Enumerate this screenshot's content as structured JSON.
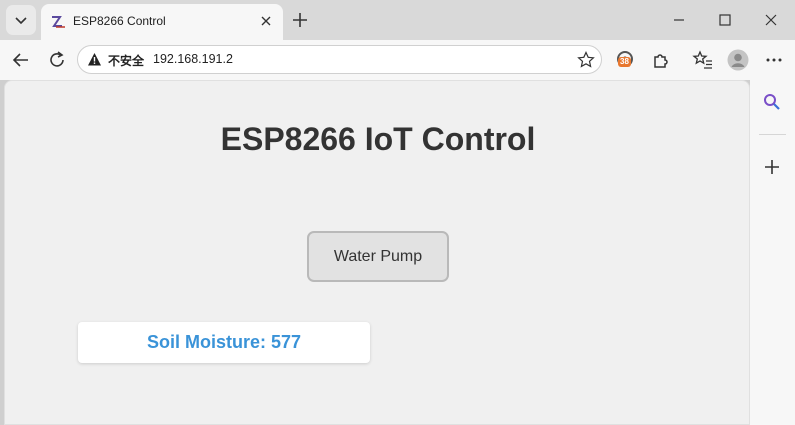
{
  "tab": {
    "title": "ESP8266 Control"
  },
  "address": {
    "security_label": "不安全",
    "url": "192.168.191.2"
  },
  "extensions": {
    "badge_count": "38"
  },
  "page": {
    "title": "ESP8266 IoT Control",
    "pump_button_label": "Water Pump",
    "moisture_text": "Soil Moisture: 577"
  },
  "colors": {
    "moisture_text": "#3a93d8",
    "background": "#f0f0f0"
  }
}
